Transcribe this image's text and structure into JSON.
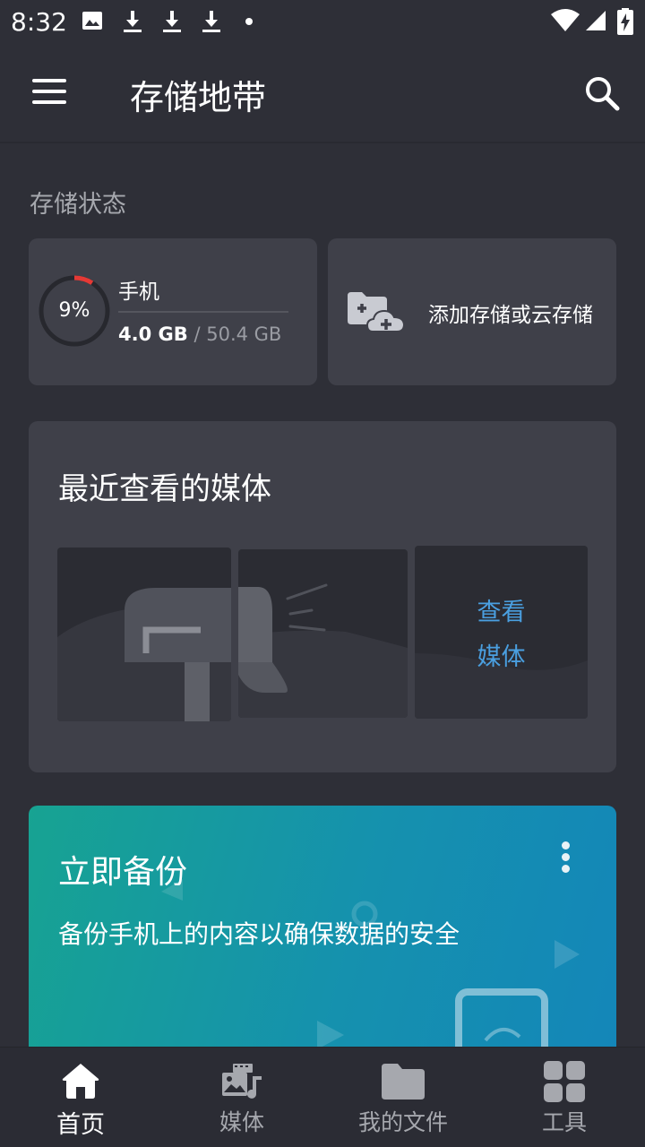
{
  "status_bar": {
    "time": "8:32"
  },
  "app_bar": {
    "title": "存储地带"
  },
  "storage_section": {
    "label": "存储状态",
    "device": {
      "name": "手机",
      "percent_text": "9%",
      "percent": 9,
      "used": "4.0 GB",
      "separator": "/",
      "total": "50.4 GB"
    },
    "add_storage_label": "添加存储或云存储"
  },
  "recent_media": {
    "title": "最近查看的媒体",
    "view_line1": "查看",
    "view_line2": "媒体"
  },
  "backup": {
    "title": "立即备份",
    "description": "备份手机上的内容以确保数据的安全"
  },
  "bottom_nav": {
    "items": [
      {
        "label": "首页",
        "icon": "home-icon",
        "active": true
      },
      {
        "label": "媒体",
        "icon": "media-icon",
        "active": false
      },
      {
        "label": "我的文件",
        "icon": "folder-icon",
        "active": false
      },
      {
        "label": "工具",
        "icon": "tools-icon",
        "active": false
      }
    ]
  },
  "colors": {
    "background": "#2e2f37",
    "card": "#3f4049",
    "accent_blue": "#4a9fe0",
    "ring_red": "#e53935"
  }
}
